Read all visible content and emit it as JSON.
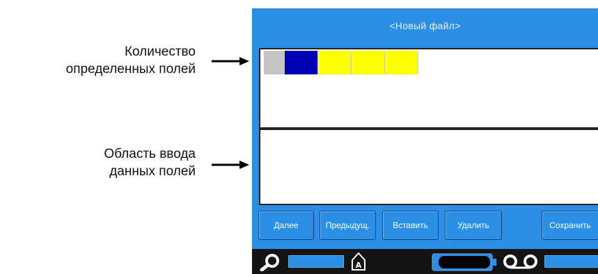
{
  "callouts": {
    "fields_count_line1": "Количество",
    "fields_count_line2": "определенных полей",
    "entry_area_line1": "Область ввода",
    "entry_area_line2": "данных полей"
  },
  "screen": {
    "title": "<Новый файл>",
    "fields": [
      {
        "color": "#c4c4c4"
      },
      {
        "color": "#0000b4"
      },
      {
        "color": "#ffff00"
      },
      {
        "color": "#ffff00"
      },
      {
        "color": "#ffff00"
      }
    ],
    "buttons": {
      "next": "Далее",
      "prev": "Предыдущ.",
      "insert": "Вставить",
      "delete": "Удалить",
      "save": "Сохранить"
    },
    "status_icons": [
      "magnifier-icon",
      "label-stock-icon",
      "battery-icon",
      "ribbon-icon"
    ]
  },
  "colors": {
    "screen_blue": "#2c8fe6",
    "status_bar": "#141414",
    "button_border": "#1b3e7a"
  }
}
